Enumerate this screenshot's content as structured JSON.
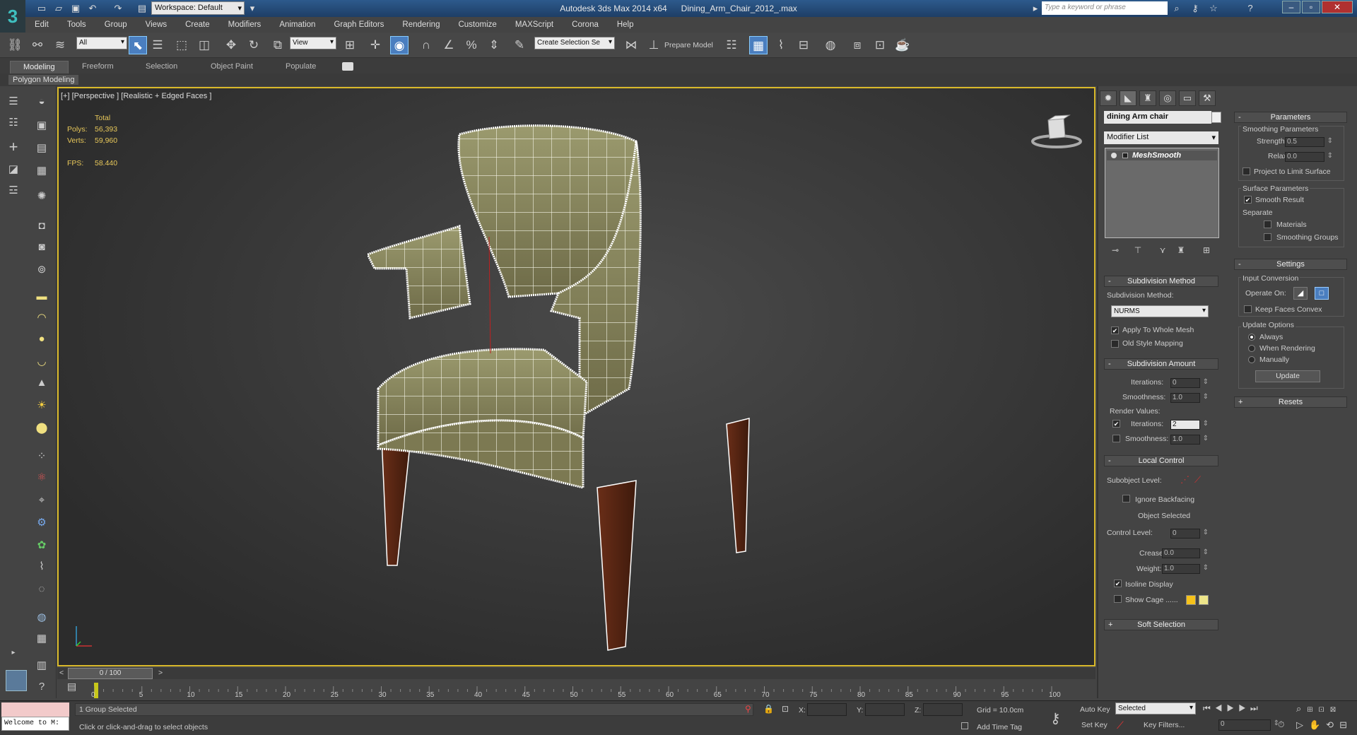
{
  "app": {
    "title": "Autodesk 3ds Max  2014 x64",
    "file": "Dining_Arm_Chair_2012_.max",
    "workspace": "Workspace: Default",
    "search_placeholder": "Type a keyword or phrase"
  },
  "menu": [
    "Edit",
    "Tools",
    "Group",
    "Views",
    "Create",
    "Modifiers",
    "Animation",
    "Graph Editors",
    "Rendering",
    "Customize",
    "MAXScript",
    "Corona",
    "Help"
  ],
  "toolbar": {
    "selection_filter": "All",
    "ref_coord": "View",
    "named_selection": "Create Selection Se",
    "prepare_model": "Prepare Model"
  },
  "ribbon": {
    "tabs": [
      "Modeling",
      "Freeform",
      "Selection",
      "Object Paint",
      "Populate"
    ],
    "panel_label": "Polygon Modeling"
  },
  "viewport": {
    "label": "[+] [Perspective ] [Realistic + Edged Faces ]",
    "stats_total": "Total",
    "polys_label": "Polys:",
    "polys_value": "56,393",
    "verts_label": "Verts:",
    "verts_value": "59,960",
    "fps_label": "FPS:",
    "fps_value": "58.440"
  },
  "command_panel": {
    "object_name": "dining Arm chair",
    "modifier_list": "Modifier List",
    "stack_item": "MeshSmooth",
    "subdivision_method": {
      "header": "Subdivision Method",
      "label": "Subdivision Method:",
      "value": "NURMS",
      "apply_whole_mesh": "Apply To Whole Mesh",
      "old_style": "Old Style Mapping"
    },
    "subdivision_amount": {
      "header": "Subdivision Amount",
      "iterations_label": "Iterations:",
      "iterations": "0",
      "smoothness_label": "Smoothness:",
      "smoothness": "1.0",
      "render_values": "Render Values:",
      "r_iterations_label": "Iterations:",
      "r_iterations": "2",
      "r_smoothness_label": "Smoothness:",
      "r_smoothness": "1.0"
    },
    "local_control": {
      "header": "Local Control",
      "subobject_label": "Subobject Level:",
      "ignore_backfacing": "Ignore Backfacing",
      "object_selected": "Object Selected",
      "control_level_label": "Control Level:",
      "control_level": "0",
      "crease_label": "Crease:",
      "crease": "0.0",
      "weight_label": "Weight:",
      "weight": "1.0",
      "isoline": "Isoline Display",
      "show_cage": "Show Cage ......"
    },
    "soft_selection": "Soft Selection",
    "parameters": {
      "header": "Parameters",
      "smoothing_params": "Smoothing Parameters",
      "strength_label": "Strength:",
      "strength": "0.5",
      "relax_label": "Relax:",
      "relax": "0.0",
      "project_limit": "Project to Limit Surface",
      "surface_params": "Surface Parameters",
      "smooth_result": "Smooth Result",
      "separate": "Separate",
      "materials": "Materials",
      "smoothing_groups": "Smoothing Groups"
    },
    "settings": {
      "header": "Settings",
      "input_conversion": "Input Conversion",
      "operate_on": "Operate On:",
      "keep_faces_convex": "Keep Faces Convex",
      "update_options": "Update Options",
      "always": "Always",
      "when_rendering": "When Rendering",
      "manually": "Manually",
      "update": "Update"
    },
    "resets": "Resets"
  },
  "timeline": {
    "slider": "0 / 100",
    "ticks": [
      "0",
      "5",
      "10",
      "15",
      "20",
      "25",
      "30",
      "35",
      "40",
      "45",
      "50",
      "55",
      "60",
      "65",
      "70",
      "75",
      "80",
      "85",
      "90",
      "95",
      "100"
    ]
  },
  "status": {
    "welcome": "Welcome to M:",
    "selection": "1 Group Selected",
    "prompt": "Click or click-and-drag to select objects",
    "x_label": "X:",
    "y_label": "Y:",
    "z_label": "Z:",
    "grid": "Grid = 10.0cm",
    "add_time_tag": "Add Time Tag",
    "auto_key": "Auto Key",
    "set_key": "Set Key",
    "key_mode": "Selected",
    "key_filters": "Key Filters...",
    "frame": "0"
  }
}
